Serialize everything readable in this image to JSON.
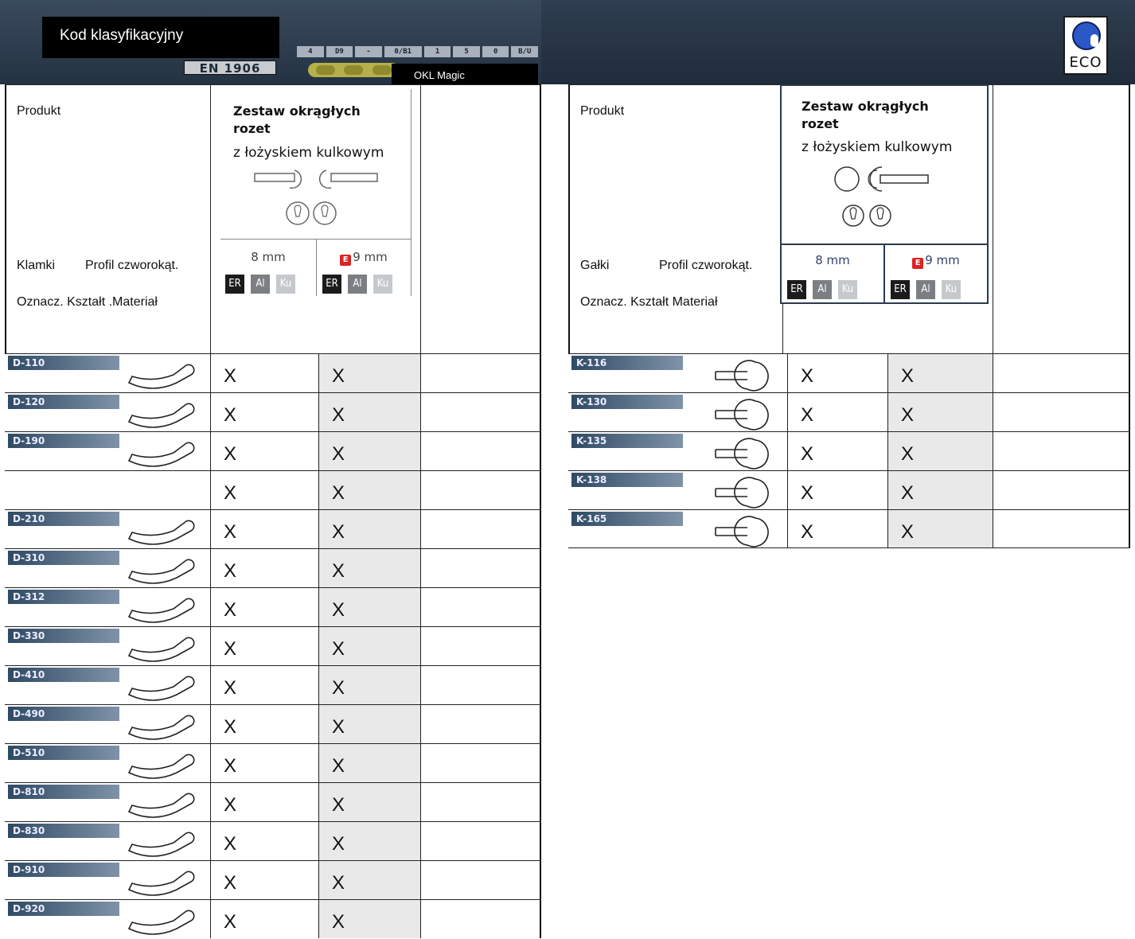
{
  "header": {
    "kod_label": "Kod klasyfikacyjny",
    "en_badge": "EN 1906",
    "code_strip": [
      "4",
      "D9",
      "-",
      "0/B1",
      "1",
      "5",
      "0",
      "B/U"
    ],
    "okl_label": "OKL Magic",
    "eco_logo_text": "ECO"
  },
  "left_table": {
    "produkt": "Produkt",
    "col2_label_a": "Klamki",
    "col2_label_b": "Profil czworokąt.",
    "col3_label": "Oznacz. Kształt .Materiał",
    "product_title": "Zestaw okrągłych rozet",
    "product_subtitle": "z łożyskiem kulkowym",
    "mm_a": "8 mm",
    "mm_b": "9 mm",
    "mm_b_badge": "E",
    "chips": [
      "ER",
      "Al",
      "Ku",
      "ER",
      "Al",
      "Ku"
    ],
    "rows": [
      {
        "code": "D-110",
        "c1": "X",
        "c2": "X"
      },
      {
        "code": "D-120",
        "c1": "X",
        "c2": "X"
      },
      {
        "code": "D-190",
        "c1": "X",
        "c2": "X"
      },
      {
        "code": "",
        "c1": "X",
        "c2": "X"
      },
      {
        "code": "D-210",
        "c1": "X",
        "c2": "X"
      },
      {
        "code": "D-310",
        "c1": "X",
        "c2": "X"
      },
      {
        "code": "D-312",
        "c1": "X",
        "c2": "X"
      },
      {
        "code": "D-330",
        "c1": "X",
        "c2": "X"
      },
      {
        "code": "D-410",
        "c1": "X",
        "c2": "X"
      },
      {
        "code": "D-490",
        "c1": "X",
        "c2": "X"
      },
      {
        "code": "D-510",
        "c1": "X",
        "c2": "X"
      },
      {
        "code": "D-810",
        "c1": "X",
        "c2": "X"
      },
      {
        "code": "D-830",
        "c1": "X",
        "c2": "X"
      },
      {
        "code": "D-910",
        "c1": "X",
        "c2": "X"
      },
      {
        "code": "D-920",
        "c1": "X",
        "c2": "X"
      }
    ]
  },
  "right_table": {
    "produkt": "Produkt",
    "col2_label_a": "Gałki",
    "col2_label_b": "Profil czworokąt.",
    "col3_label": "Oznacz.  Kształt  Materiał",
    "product_title": "Zestaw okrągłych rozet",
    "product_subtitle": "z łożyskiem kulkowym",
    "mm_a": "8 mm",
    "mm_b": "9 mm",
    "mm_b_badge": "E",
    "chips": [
      "ER",
      "Al",
      "Ku",
      "ER",
      "Al",
      "Ku"
    ],
    "rows": [
      {
        "code": "K-116",
        "c1": "X",
        "c2": "X"
      },
      {
        "code": "K-130",
        "c1": "X",
        "c2": "X"
      },
      {
        "code": "K-135",
        "c1": "X",
        "c2": "X"
      },
      {
        "code": "K-138",
        "c1": "X",
        "c2": "X"
      },
      {
        "code": "K-165",
        "c1": "X",
        "c2": "X"
      }
    ]
  }
}
